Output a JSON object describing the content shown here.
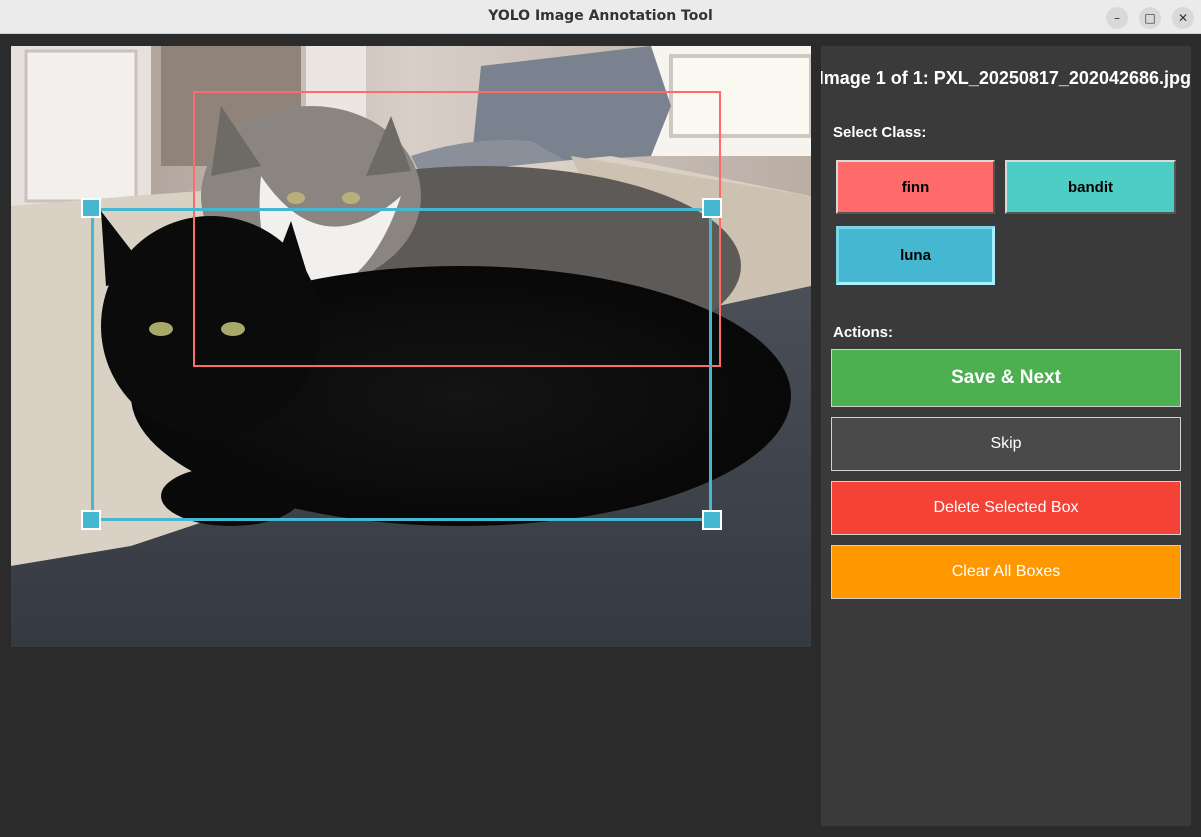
{
  "window": {
    "title": "YOLO Image Annotation Tool",
    "minimize_glyph": "–",
    "maximize_glyph": "□",
    "close_glyph": "✕"
  },
  "image_label": "Image 1 of 1: PXL_20250817_202042686.jpg",
  "class_section_label": "Select Class:",
  "classes": [
    {
      "label": "finn",
      "color": "#ff6b6b",
      "selected": false
    },
    {
      "label": "bandit",
      "color": "#4ecdc4",
      "selected": false
    },
    {
      "label": "luna",
      "color": "#45b7d1",
      "selected": true
    }
  ],
  "actions_section_label": "Actions:",
  "actions": {
    "save_next": {
      "label": "Save & Next",
      "color": "#4caf50"
    },
    "skip": {
      "label": "Skip",
      "color": "#4a4a4a"
    },
    "delete": {
      "label": "Delete Selected Box",
      "color": "#f44336"
    },
    "clear": {
      "label": "Clear All Boxes",
      "color": "#ff9800"
    }
  },
  "annotations": [
    {
      "class": "finn",
      "color": "#ff6b6b",
      "selected": false
    },
    {
      "class": "luna",
      "color": "#45b7d1",
      "selected": true
    }
  ],
  "image_subject": "two cats lying on a bed"
}
